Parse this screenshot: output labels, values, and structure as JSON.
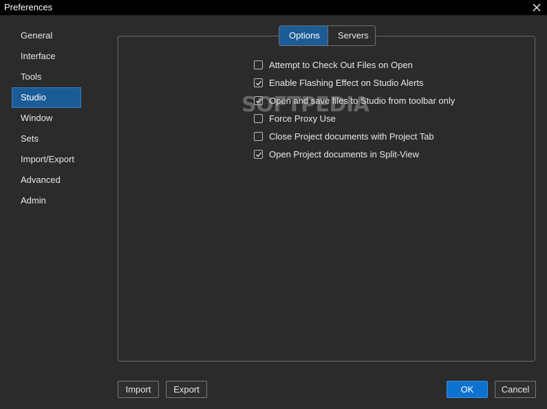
{
  "window": {
    "title": "Preferences"
  },
  "sidebar": {
    "items": [
      {
        "label": "General"
      },
      {
        "label": "Interface"
      },
      {
        "label": "Tools"
      },
      {
        "label": "Studio",
        "active": true
      },
      {
        "label": "Window"
      },
      {
        "label": "Sets"
      },
      {
        "label": "Import/Export"
      },
      {
        "label": "Advanced"
      },
      {
        "label": "Admin"
      }
    ]
  },
  "tabs": [
    {
      "label": "Options",
      "active": true
    },
    {
      "label": "Servers",
      "active": false
    }
  ],
  "options": [
    {
      "label": "Attempt to Check Out Files on Open",
      "checked": false
    },
    {
      "label": "Enable Flashing Effect on Studio Alerts",
      "checked": true
    },
    {
      "label": "Open and save files to Studio from toolbar only",
      "checked": true
    },
    {
      "label": "Force Proxy Use",
      "checked": false
    },
    {
      "label": "Close Project documents with Project Tab",
      "checked": false
    },
    {
      "label": "Open Project documents in Split-View",
      "checked": true
    }
  ],
  "watermark": "SOFTPEDIA",
  "buttons": {
    "import": "Import",
    "export": "Export",
    "ok": "OK",
    "cancel": "Cancel"
  },
  "colors": {
    "accent": "#1c5c96",
    "primary_button": "#0e72d0",
    "background": "#2b2b2b",
    "titlebar": "#000000"
  }
}
